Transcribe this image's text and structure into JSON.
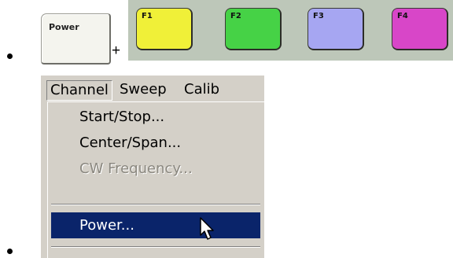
{
  "keys": {
    "power_label": "Power",
    "plus": "+",
    "function_keys": [
      {
        "label": "F1",
        "color": "#f0f038"
      },
      {
        "label": "F2",
        "color": "#46d246"
      },
      {
        "label": "F3",
        "color": "#a6a6f2"
      },
      {
        "label": "F4",
        "color": "#d846c8"
      }
    ]
  },
  "menubar": {
    "items": [
      "Channel",
      "Sweep",
      "Calib"
    ]
  },
  "channel_menu": {
    "items": [
      {
        "label": "Start/Stop...",
        "state": "enabled"
      },
      {
        "label": "Center/Span...",
        "state": "enabled"
      },
      {
        "label": "CW Frequency...",
        "state": "disabled"
      },
      {
        "label": "Power...",
        "state": "highlighted"
      }
    ]
  },
  "colors": {
    "highlight": "#0a246a",
    "menu_background": "#d4d0c8",
    "strip_background": "#bdc7b9"
  }
}
